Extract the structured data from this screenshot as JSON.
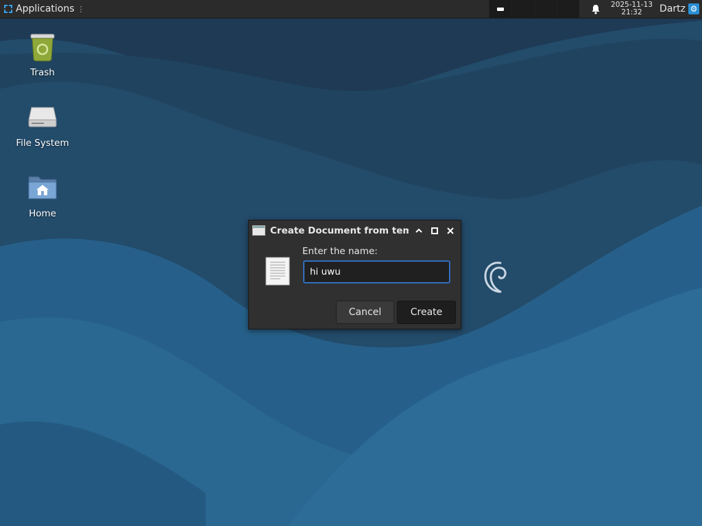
{
  "panel": {
    "applications_label": "Applications",
    "applications_sep": "⋮",
    "clock_date": "2025-11-13",
    "clock_time": "21:32",
    "user": "Dartz"
  },
  "desktop": {
    "icons": [
      {
        "label": "Trash",
        "icon": "trash-icon"
      },
      {
        "label": "File System",
        "icon": "drive-icon"
      },
      {
        "label": "Home",
        "icon": "home-folder-icon"
      }
    ]
  },
  "dialog": {
    "title": "Create Document from templ",
    "prompt": "Enter the name:",
    "input_value": "hi uwu",
    "cancel_label": "Cancel",
    "create_label": "Create"
  },
  "colors": {
    "panel_bg": "#2b2b2b",
    "accent": "#3b7fd8",
    "wallpaper": "#1f4a6b"
  }
}
